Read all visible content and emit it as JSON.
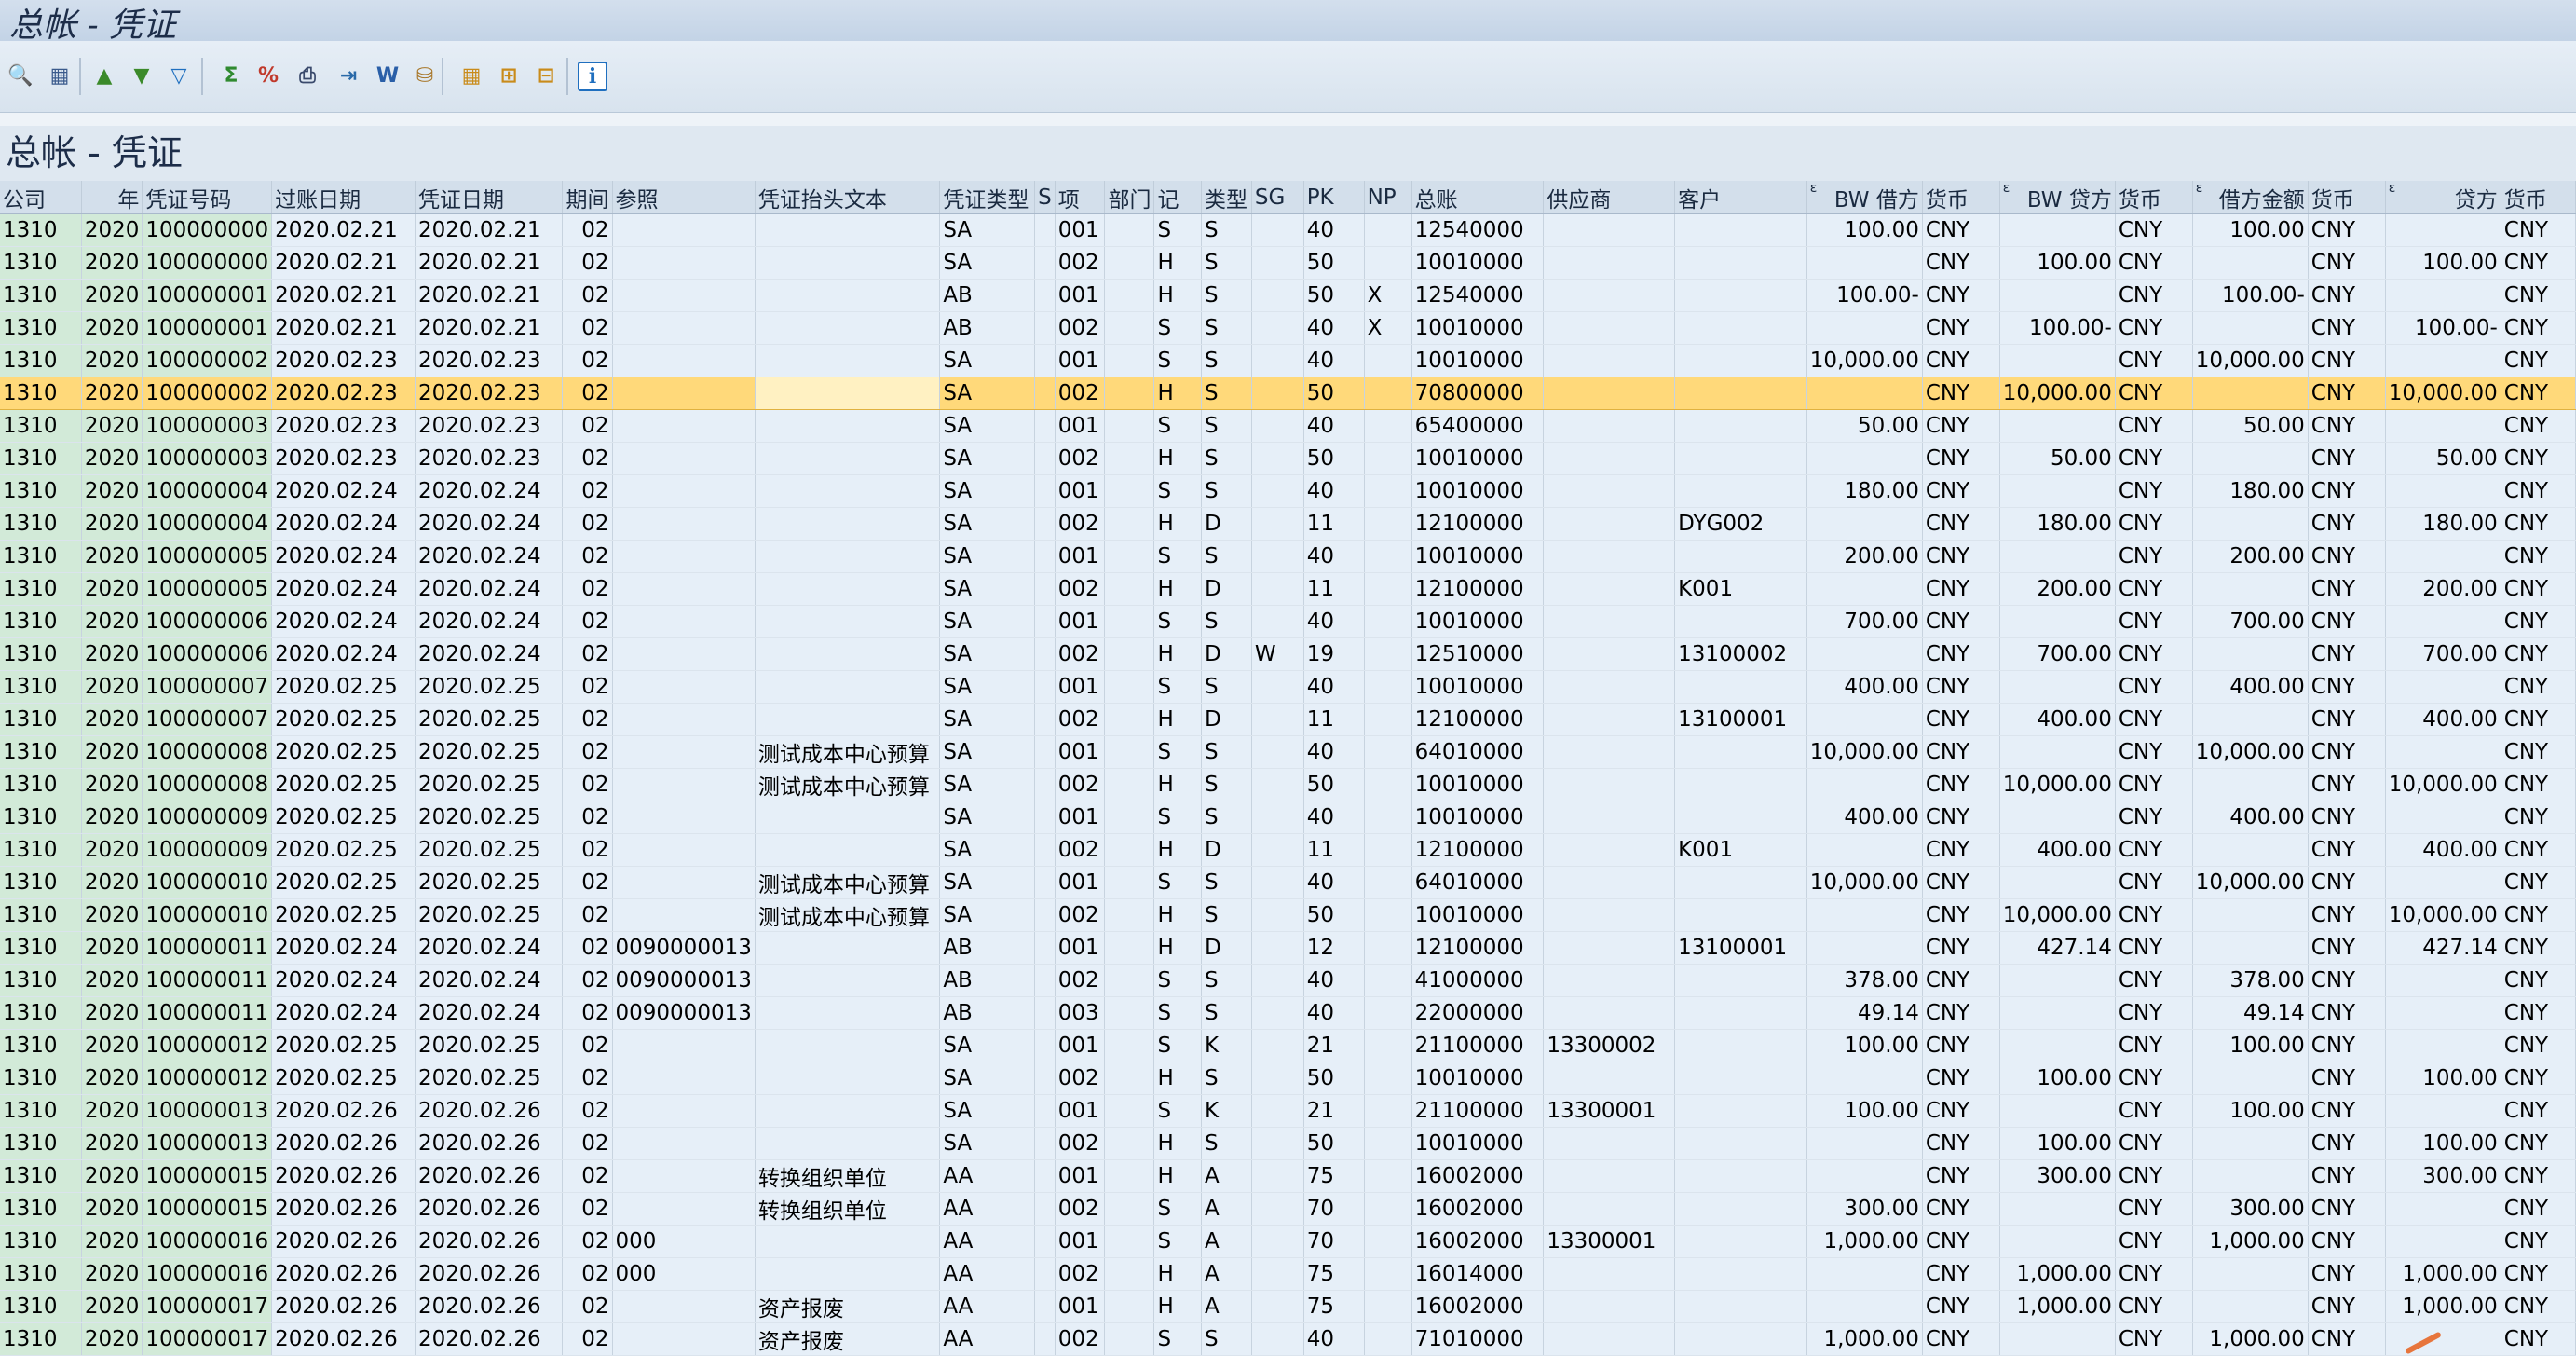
{
  "window": {
    "title": "总帐 - 凭证"
  },
  "report": {
    "title": "总帐 - 凭证"
  },
  "toolbar": {
    "buttons": [
      {
        "name": "detail-view-icon",
        "glyph": "🔍",
        "color": "#2b6b2b"
      },
      {
        "name": "change-layout-icon",
        "glyph": "▦",
        "color": "#3a5a8c"
      },
      {
        "name": "sort-ascending-icon",
        "glyph": "▲",
        "color": "#3b8a2a"
      },
      {
        "name": "sort-descending-icon",
        "glyph": "▼",
        "color": "#3b8a2a"
      },
      {
        "name": "filter-icon",
        "glyph": "▽",
        "color": "#1f6fbf"
      },
      {
        "name": "sum-icon",
        "glyph": "Σ",
        "color": "#2f8a2f"
      },
      {
        "name": "subtotal-icon",
        "glyph": "%",
        "color": "#c0392b"
      },
      {
        "name": "print-preview-icon",
        "glyph": "⎙",
        "color": "#3a4a6c"
      },
      {
        "name": "export-icon",
        "glyph": "⇥",
        "color": "#2a6aa8"
      },
      {
        "name": "word-processing-icon",
        "glyph": "W",
        "color": "#2a5fa8"
      },
      {
        "name": "local-file-icon",
        "glyph": "⛁",
        "color": "#a8772a"
      },
      {
        "name": "layout-grid-icon",
        "glyph": "▦",
        "color": "#c98b1a"
      },
      {
        "name": "choose-layout-icon",
        "glyph": "⊞",
        "color": "#c98b1a"
      },
      {
        "name": "save-layout-icon",
        "glyph": "⊟",
        "color": "#c98b1a"
      },
      {
        "name": "information-icon",
        "glyph": "i",
        "color": "#1f6fbf"
      }
    ]
  },
  "columns": [
    "公司",
    "年",
    "凭证号码",
    "过账日期",
    "凭证日期",
    "期间",
    "参照",
    "凭证抬头文本",
    "凭证类型",
    "S",
    "项",
    "部门",
    "记",
    "类型",
    "SG",
    "PK",
    "NP",
    "总账",
    "供应商",
    "客户",
    "BW 借方",
    "货币",
    "BW 贷方",
    "货币",
    "借方金额",
    "货币",
    "贷方",
    "货币"
  ],
  "sum_marker": "ε",
  "rows": [
    [
      "1310",
      "2020",
      "100000000",
      "2020.02.21",
      "2020.02.21",
      "02",
      "",
      "",
      "SA",
      "",
      "001",
      "",
      "S",
      "S",
      "",
      "40",
      "",
      "12540000",
      "",
      "",
      "100.00",
      "CNY",
      "",
      "CNY",
      "100.00",
      "CNY",
      "",
      "CNY"
    ],
    [
      "1310",
      "2020",
      "100000000",
      "2020.02.21",
      "2020.02.21",
      "02",
      "",
      "",
      "SA",
      "",
      "002",
      "",
      "H",
      "S",
      "",
      "50",
      "",
      "10010000",
      "",
      "",
      "",
      "CNY",
      "100.00",
      "CNY",
      "",
      "CNY",
      "100.00",
      "CNY"
    ],
    [
      "1310",
      "2020",
      "100000001",
      "2020.02.21",
      "2020.02.21",
      "02",
      "",
      "",
      "AB",
      "",
      "001",
      "",
      "H",
      "S",
      "",
      "50",
      "X",
      "12540000",
      "",
      "",
      "100.00-",
      "CNY",
      "",
      "CNY",
      "100.00-",
      "CNY",
      "",
      "CNY"
    ],
    [
      "1310",
      "2020",
      "100000001",
      "2020.02.21",
      "2020.02.21",
      "02",
      "",
      "",
      "AB",
      "",
      "002",
      "",
      "S",
      "S",
      "",
      "40",
      "X",
      "10010000",
      "",
      "",
      "",
      "CNY",
      "100.00-",
      "CNY",
      "",
      "CNY",
      "100.00-",
      "CNY"
    ],
    [
      "1310",
      "2020",
      "100000002",
      "2020.02.23",
      "2020.02.23",
      "02",
      "",
      "",
      "SA",
      "",
      "001",
      "",
      "S",
      "S",
      "",
      "40",
      "",
      "10010000",
      "",
      "",
      "10,000.00",
      "CNY",
      "",
      "CNY",
      "10,000.00",
      "CNY",
      "",
      "CNY"
    ],
    [
      "1310",
      "2020",
      "100000002",
      "2020.02.23",
      "2020.02.23",
      "02",
      "",
      "",
      "SA",
      "",
      "002",
      "",
      "H",
      "S",
      "",
      "50",
      "",
      "70800000",
      "",
      "",
      "",
      "CNY",
      "10,000.00",
      "CNY",
      "",
      "CNY",
      "10,000.00",
      "CNY"
    ],
    [
      "1310",
      "2020",
      "100000003",
      "2020.02.23",
      "2020.02.23",
      "02",
      "",
      "",
      "SA",
      "",
      "001",
      "",
      "S",
      "S",
      "",
      "40",
      "",
      "65400000",
      "",
      "",
      "50.00",
      "CNY",
      "",
      "CNY",
      "50.00",
      "CNY",
      "",
      "CNY"
    ],
    [
      "1310",
      "2020",
      "100000003",
      "2020.02.23",
      "2020.02.23",
      "02",
      "",
      "",
      "SA",
      "",
      "002",
      "",
      "H",
      "S",
      "",
      "50",
      "",
      "10010000",
      "",
      "",
      "",
      "CNY",
      "50.00",
      "CNY",
      "",
      "CNY",
      "50.00",
      "CNY"
    ],
    [
      "1310",
      "2020",
      "100000004",
      "2020.02.24",
      "2020.02.24",
      "02",
      "",
      "",
      "SA",
      "",
      "001",
      "",
      "S",
      "S",
      "",
      "40",
      "",
      "10010000",
      "",
      "",
      "180.00",
      "CNY",
      "",
      "CNY",
      "180.00",
      "CNY",
      "",
      "CNY"
    ],
    [
      "1310",
      "2020",
      "100000004",
      "2020.02.24",
      "2020.02.24",
      "02",
      "",
      "",
      "SA",
      "",
      "002",
      "",
      "H",
      "D",
      "",
      "11",
      "",
      "12100000",
      "",
      "DYG002",
      "",
      "CNY",
      "180.00",
      "CNY",
      "",
      "CNY",
      "180.00",
      "CNY"
    ],
    [
      "1310",
      "2020",
      "100000005",
      "2020.02.24",
      "2020.02.24",
      "02",
      "",
      "",
      "SA",
      "",
      "001",
      "",
      "S",
      "S",
      "",
      "40",
      "",
      "10010000",
      "",
      "",
      "200.00",
      "CNY",
      "",
      "CNY",
      "200.00",
      "CNY",
      "",
      "CNY"
    ],
    [
      "1310",
      "2020",
      "100000005",
      "2020.02.24",
      "2020.02.24",
      "02",
      "",
      "",
      "SA",
      "",
      "002",
      "",
      "H",
      "D",
      "",
      "11",
      "",
      "12100000",
      "",
      "K001",
      "",
      "CNY",
      "200.00",
      "CNY",
      "",
      "CNY",
      "200.00",
      "CNY"
    ],
    [
      "1310",
      "2020",
      "100000006",
      "2020.02.24",
      "2020.02.24",
      "02",
      "",
      "",
      "SA",
      "",
      "001",
      "",
      "S",
      "S",
      "",
      "40",
      "",
      "10010000",
      "",
      "",
      "700.00",
      "CNY",
      "",
      "CNY",
      "700.00",
      "CNY",
      "",
      "CNY"
    ],
    [
      "1310",
      "2020",
      "100000006",
      "2020.02.24",
      "2020.02.24",
      "02",
      "",
      "",
      "SA",
      "",
      "002",
      "",
      "H",
      "D",
      "W",
      "19",
      "",
      "12510000",
      "",
      "13100002",
      "",
      "CNY",
      "700.00",
      "CNY",
      "",
      "CNY",
      "700.00",
      "CNY"
    ],
    [
      "1310",
      "2020",
      "100000007",
      "2020.02.25",
      "2020.02.25",
      "02",
      "",
      "",
      "SA",
      "",
      "001",
      "",
      "S",
      "S",
      "",
      "40",
      "",
      "10010000",
      "",
      "",
      "400.00",
      "CNY",
      "",
      "CNY",
      "400.00",
      "CNY",
      "",
      "CNY"
    ],
    [
      "1310",
      "2020",
      "100000007",
      "2020.02.25",
      "2020.02.25",
      "02",
      "",
      "",
      "SA",
      "",
      "002",
      "",
      "H",
      "D",
      "",
      "11",
      "",
      "12100000",
      "",
      "13100001",
      "",
      "CNY",
      "400.00",
      "CNY",
      "",
      "CNY",
      "400.00",
      "CNY"
    ],
    [
      "1310",
      "2020",
      "100000008",
      "2020.02.25",
      "2020.02.25",
      "02",
      "",
      "测试成本中心预算",
      "SA",
      "",
      "001",
      "",
      "S",
      "S",
      "",
      "40",
      "",
      "64010000",
      "",
      "",
      "10,000.00",
      "CNY",
      "",
      "CNY",
      "10,000.00",
      "CNY",
      "",
      "CNY"
    ],
    [
      "1310",
      "2020",
      "100000008",
      "2020.02.25",
      "2020.02.25",
      "02",
      "",
      "测试成本中心预算",
      "SA",
      "",
      "002",
      "",
      "H",
      "S",
      "",
      "50",
      "",
      "10010000",
      "",
      "",
      "",
      "CNY",
      "10,000.00",
      "CNY",
      "",
      "CNY",
      "10,000.00",
      "CNY"
    ],
    [
      "1310",
      "2020",
      "100000009",
      "2020.02.25",
      "2020.02.25",
      "02",
      "",
      "",
      "SA",
      "",
      "001",
      "",
      "S",
      "S",
      "",
      "40",
      "",
      "10010000",
      "",
      "",
      "400.00",
      "CNY",
      "",
      "CNY",
      "400.00",
      "CNY",
      "",
      "CNY"
    ],
    [
      "1310",
      "2020",
      "100000009",
      "2020.02.25",
      "2020.02.25",
      "02",
      "",
      "",
      "SA",
      "",
      "002",
      "",
      "H",
      "D",
      "",
      "11",
      "",
      "12100000",
      "",
      "K001",
      "",
      "CNY",
      "400.00",
      "CNY",
      "",
      "CNY",
      "400.00",
      "CNY"
    ],
    [
      "1310",
      "2020",
      "100000010",
      "2020.02.25",
      "2020.02.25",
      "02",
      "",
      "测试成本中心预算",
      "SA",
      "",
      "001",
      "",
      "S",
      "S",
      "",
      "40",
      "",
      "64010000",
      "",
      "",
      "10,000.00",
      "CNY",
      "",
      "CNY",
      "10,000.00",
      "CNY",
      "",
      "CNY"
    ],
    [
      "1310",
      "2020",
      "100000010",
      "2020.02.25",
      "2020.02.25",
      "02",
      "",
      "测试成本中心预算",
      "SA",
      "",
      "002",
      "",
      "H",
      "S",
      "",
      "50",
      "",
      "10010000",
      "",
      "",
      "",
      "CNY",
      "10,000.00",
      "CNY",
      "",
      "CNY",
      "10,000.00",
      "CNY"
    ],
    [
      "1310",
      "2020",
      "100000011",
      "2020.02.24",
      "2020.02.24",
      "02",
      "0090000013",
      "",
      "AB",
      "",
      "001",
      "",
      "H",
      "D",
      "",
      "12",
      "",
      "12100000",
      "",
      "13100001",
      "",
      "CNY",
      "427.14",
      "CNY",
      "",
      "CNY",
      "427.14",
      "CNY"
    ],
    [
      "1310",
      "2020",
      "100000011",
      "2020.02.24",
      "2020.02.24",
      "02",
      "0090000013",
      "",
      "AB",
      "",
      "002",
      "",
      "S",
      "S",
      "",
      "40",
      "",
      "41000000",
      "",
      "",
      "378.00",
      "CNY",
      "",
      "CNY",
      "378.00",
      "CNY",
      "",
      "CNY"
    ],
    [
      "1310",
      "2020",
      "100000011",
      "2020.02.24",
      "2020.02.24",
      "02",
      "0090000013",
      "",
      "AB",
      "",
      "003",
      "",
      "S",
      "S",
      "",
      "40",
      "",
      "22000000",
      "",
      "",
      "49.14",
      "CNY",
      "",
      "CNY",
      "49.14",
      "CNY",
      "",
      "CNY"
    ],
    [
      "1310",
      "2020",
      "100000012",
      "2020.02.25",
      "2020.02.25",
      "02",
      "",
      "",
      "SA",
      "",
      "001",
      "",
      "S",
      "K",
      "",
      "21",
      "",
      "21100000",
      "13300002",
      "",
      "100.00",
      "CNY",
      "",
      "CNY",
      "100.00",
      "CNY",
      "",
      "CNY"
    ],
    [
      "1310",
      "2020",
      "100000012",
      "2020.02.25",
      "2020.02.25",
      "02",
      "",
      "",
      "SA",
      "",
      "002",
      "",
      "H",
      "S",
      "",
      "50",
      "",
      "10010000",
      "",
      "",
      "",
      "CNY",
      "100.00",
      "CNY",
      "",
      "CNY",
      "100.00",
      "CNY"
    ],
    [
      "1310",
      "2020",
      "100000013",
      "2020.02.26",
      "2020.02.26",
      "02",
      "",
      "",
      "SA",
      "",
      "001",
      "",
      "S",
      "K",
      "",
      "21",
      "",
      "21100000",
      "13300001",
      "",
      "100.00",
      "CNY",
      "",
      "CNY",
      "100.00",
      "CNY",
      "",
      "CNY"
    ],
    [
      "1310",
      "2020",
      "100000013",
      "2020.02.26",
      "2020.02.26",
      "02",
      "",
      "",
      "SA",
      "",
      "002",
      "",
      "H",
      "S",
      "",
      "50",
      "",
      "10010000",
      "",
      "",
      "",
      "CNY",
      "100.00",
      "CNY",
      "",
      "CNY",
      "100.00",
      "CNY"
    ],
    [
      "1310",
      "2020",
      "100000015",
      "2020.02.26",
      "2020.02.26",
      "02",
      "",
      "转换组织单位",
      "AA",
      "",
      "001",
      "",
      "H",
      "A",
      "",
      "75",
      "",
      "16002000",
      "",
      "",
      "",
      "CNY",
      "300.00",
      "CNY",
      "",
      "CNY",
      "300.00",
      "CNY"
    ],
    [
      "1310",
      "2020",
      "100000015",
      "2020.02.26",
      "2020.02.26",
      "02",
      "",
      "转换组织单位",
      "AA",
      "",
      "002",
      "",
      "S",
      "A",
      "",
      "70",
      "",
      "16002000",
      "",
      "",
      "300.00",
      "CNY",
      "",
      "CNY",
      "300.00",
      "CNY",
      "",
      "CNY"
    ],
    [
      "1310",
      "2020",
      "100000016",
      "2020.02.26",
      "2020.02.26",
      "02",
      "000",
      "",
      "AA",
      "",
      "001",
      "",
      "S",
      "A",
      "",
      "70",
      "",
      "16002000",
      "13300001",
      "",
      "1,000.00",
      "CNY",
      "",
      "CNY",
      "1,000.00",
      "CNY",
      "",
      "CNY"
    ],
    [
      "1310",
      "2020",
      "100000016",
      "2020.02.26",
      "2020.02.26",
      "02",
      "000",
      "",
      "AA",
      "",
      "002",
      "",
      "H",
      "A",
      "",
      "75",
      "",
      "16014000",
      "",
      "",
      "",
      "CNY",
      "1,000.00",
      "CNY",
      "",
      "CNY",
      "1,000.00",
      "CNY"
    ],
    [
      "1310",
      "2020",
      "100000017",
      "2020.02.26",
      "2020.02.26",
      "02",
      "",
      "资产报废",
      "AA",
      "",
      "001",
      "",
      "H",
      "A",
      "",
      "75",
      "",
      "16002000",
      "",
      "",
      "",
      "CNY",
      "1,000.00",
      "CNY",
      "",
      "CNY",
      "1,000.00",
      "CNY"
    ],
    [
      "1310",
      "2020",
      "100000017",
      "2020.02.26",
      "2020.02.26",
      "02",
      "",
      "资产报废",
      "AA",
      "",
      "002",
      "",
      "S",
      "S",
      "",
      "40",
      "",
      "71010000",
      "",
      "",
      "1,000.00",
      "CNY",
      "",
      "CNY",
      "1,000.00",
      "CNY",
      "",
      "CNY"
    ]
  ],
  "selected_row": 5
}
